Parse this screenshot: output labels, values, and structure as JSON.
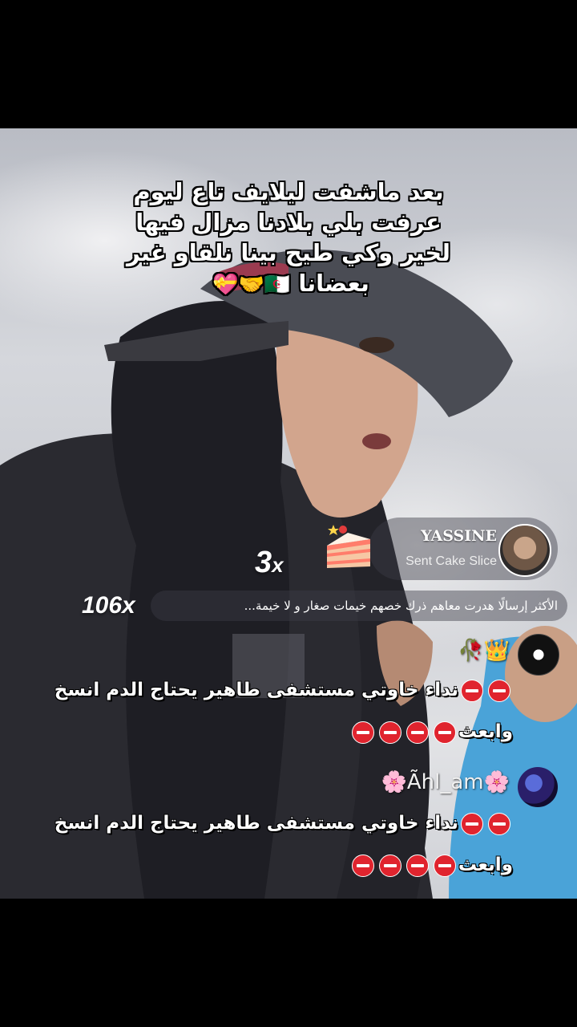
{
  "caption": {
    "lines": [
      "بعد ماشفت ليلايف تاع ليوم",
      "عرفت بلي بلادنا مزال فيها",
      "لخير وكي طيح بينا نلقاو غير",
      "بعضانا"
    ],
    "emojis": "🇩🇿🤝💝"
  },
  "gift": {
    "sender": "YASSINE",
    "action": "Sent Cake Slice",
    "count": "3",
    "count_suffix": "x",
    "icon": "cake-slice-icon"
  },
  "combo": "106x",
  "top_comment": "الأكثر إرسالًا هدرت معاهم ذرك خصهم خيمات صغار و لا خيمة...",
  "chat": [
    {
      "user": "👑🥀",
      "avatar": "moon-avatar",
      "message_text": "نداء خاوتي مستشفى طاهير يحتاج الدم انسخ وابعث"
    },
    {
      "user": "🌸Ãhl_am🌸",
      "avatar": "galaxy-avatar",
      "message_text": "نداء خاوتي مستشفى طاهير يحتاج الدم انسخ وابعث"
    }
  ]
}
